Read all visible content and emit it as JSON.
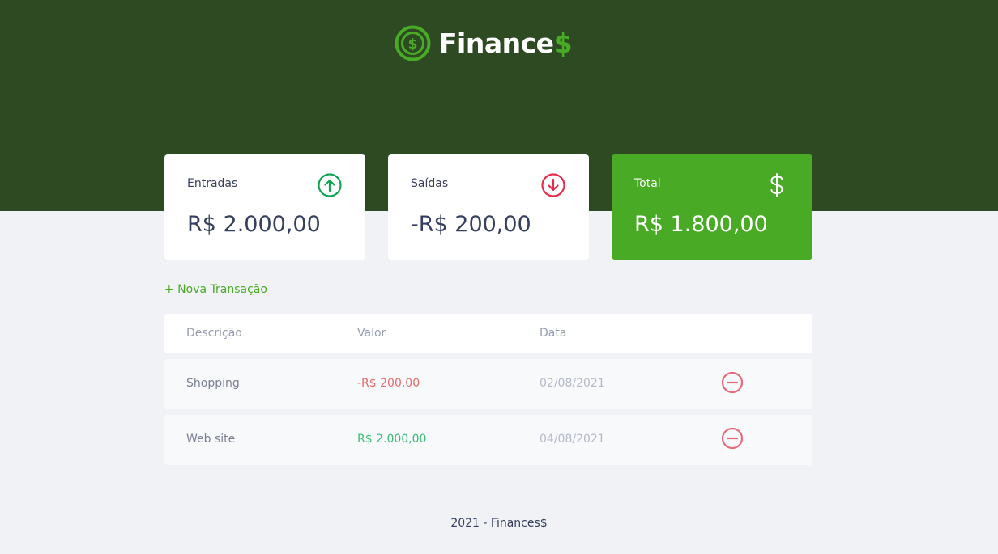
{
  "header": {
    "logo_text": "Finance",
    "logo_accent": "$"
  },
  "cards": {
    "income": {
      "label": "Entradas",
      "value": "R$ 2.000,00",
      "icon": "arrow-up-circle-icon"
    },
    "expense": {
      "label": "Saídas",
      "value": "-R$ 200,00",
      "icon": "arrow-down-circle-icon"
    },
    "total": {
      "label": "Total",
      "value": "R$ 1.800,00",
      "icon": "dollar-sign-icon"
    }
  },
  "new_transaction_label": "+ Nova Transação",
  "table": {
    "headers": {
      "description": "Descrição",
      "amount": "Valor",
      "date": "Data"
    },
    "rows": [
      {
        "description": "Shopping",
        "amount": "-R$ 200,00",
        "date": "02/08/2021",
        "type": "expense"
      },
      {
        "description": "Web site",
        "amount": "R$ 2.000,00",
        "date": "04/08/2021",
        "type": "income"
      }
    ]
  },
  "footer": "2021 - Finances$",
  "colors": {
    "header_bg": "#2d4a22",
    "accent": "#49aa26",
    "income": "#3dbb76",
    "expense": "#e56b6b",
    "page_bg": "#f0f2f5"
  }
}
